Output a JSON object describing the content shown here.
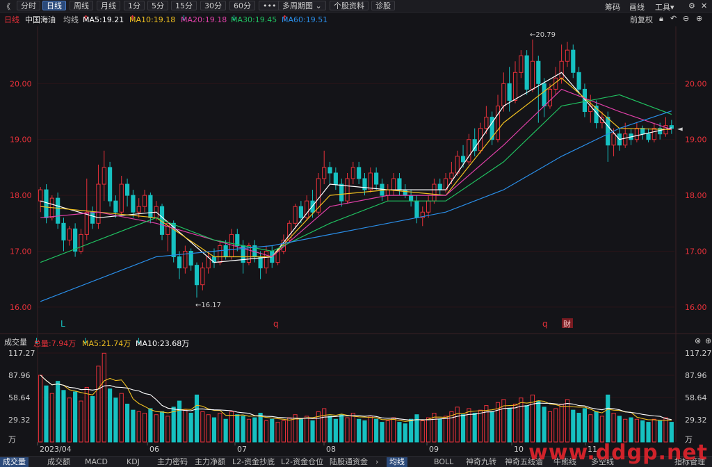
{
  "toolbar": {
    "back": "《",
    "tabs": [
      "分时",
      "日线",
      "周线",
      "月线",
      "1分",
      "5分",
      "15分",
      "30分",
      "60分",
      "•••",
      "多周期图",
      "个股资料",
      "诊股"
    ],
    "active_tab": "日线",
    "right": [
      "筹码",
      "画线",
      "工具"
    ]
  },
  "header": {
    "period": "日线",
    "name": "中国海油",
    "avg_label": "均线",
    "ma5": "MA5:19.21",
    "ma10": "MA10:19.18",
    "ma20": "MA20:19.18",
    "ma30": "MA30:19.45",
    "ma60": "MA60:19.51",
    "ma5_arrow": "↑",
    "ma10_arrow": "↑",
    "ma20_arrow": "↓",
    "ma30_arrow": "↓",
    "ma60_arrow": "↑",
    "adjust": "前复权"
  },
  "colors": {
    "up": "#e8313a",
    "down": "#16c1c1",
    "ma5": "#ffffff",
    "ma10": "#f0c020",
    "ma20": "#e040a8",
    "ma30": "#20c060",
    "ma60": "#2a8ee8",
    "grid": "#2a1418"
  },
  "price_axis": {
    "ticks": [
      "20.00",
      "19.00",
      "18.00",
      "17.00",
      "16.00"
    ]
  },
  "annotations": {
    "high": "20.79",
    "low": "16.17",
    "markers": [
      "L",
      "q",
      "q",
      "财"
    ]
  },
  "volume": {
    "title": "成交量",
    "total": "总量:7.94万",
    "total_arrow": "↓",
    "ma5": "MA5:21.74万",
    "ma5_arrow": "↓",
    "ma10": "MA10:23.68万",
    "ma10_arrow": "↓",
    "ticks": [
      "117.27",
      "87.96",
      "58.64",
      "29.32",
      "万"
    ]
  },
  "xaxis": {
    "labels": [
      "2023/04",
      "06",
      "07",
      "08",
      "09",
      "10",
      "11"
    ]
  },
  "bottom_tabs_left": [
    "成交量",
    "成交额",
    "MACD",
    "KDJ",
    "主力密码",
    "主力净额",
    "L2-资金抄底",
    "L2-资金仓位",
    "陆股通资金"
  ],
  "bottom_tabs_right": [
    "均线",
    "BOLL",
    "神奇九转",
    "神奇五线谱",
    "牛熊线",
    "多空线",
    "指标管理"
  ],
  "watermark": "www.ddgp.net",
  "chart_data": {
    "type": "candlestick",
    "title": "中国海油 日线",
    "ylim": [
      15.7,
      20.95
    ],
    "candles": [
      [
        17.9,
        18.1,
        17.7,
        18.15
      ],
      [
        18.1,
        17.6,
        17.5,
        18.2
      ],
      [
        17.6,
        17.95,
        17.55,
        18.0
      ],
      [
        17.95,
        17.5,
        17.4,
        18.05
      ],
      [
        17.5,
        17.2,
        17.0,
        17.6
      ],
      [
        17.2,
        17.4,
        17.1,
        17.45
      ],
      [
        17.4,
        17.0,
        16.9,
        17.5
      ],
      [
        17.0,
        17.3,
        16.95,
        17.4
      ],
      [
        17.3,
        17.7,
        17.2,
        18.3
      ],
      [
        17.7,
        17.5,
        17.4,
        17.8
      ],
      [
        17.5,
        18.2,
        17.4,
        18.55
      ],
      [
        18.2,
        18.5,
        17.9,
        18.8
      ],
      [
        18.5,
        17.9,
        17.8,
        18.6
      ],
      [
        17.9,
        17.7,
        17.6,
        18.0
      ],
      [
        17.7,
        18.2,
        17.65,
        18.35
      ],
      [
        18.2,
        18.0,
        17.8,
        18.3
      ],
      [
        18.0,
        17.7,
        17.6,
        18.1
      ],
      [
        17.7,
        17.8,
        17.6,
        17.95
      ],
      [
        17.8,
        18.0,
        17.7,
        18.1
      ],
      [
        18.0,
        17.6,
        17.5,
        18.05
      ],
      [
        17.6,
        17.8,
        17.55,
        17.9
      ],
      [
        17.8,
        17.3,
        17.2,
        17.85
      ],
      [
        17.3,
        17.5,
        17.0,
        17.55
      ],
      [
        17.5,
        16.9,
        16.8,
        17.55
      ],
      [
        16.9,
        16.7,
        16.5,
        17.0
      ],
      [
        16.7,
        17.0,
        16.6,
        17.1
      ],
      [
        17.0,
        16.75,
        16.65,
        17.05
      ],
      [
        16.75,
        16.4,
        16.17,
        16.8
      ],
      [
        16.4,
        16.7,
        16.3,
        16.8
      ],
      [
        16.7,
        16.9,
        16.6,
        17.0
      ],
      [
        16.9,
        16.8,
        16.7,
        17.05
      ],
      [
        16.8,
        17.1,
        16.75,
        17.2
      ],
      [
        17.1,
        16.9,
        16.85,
        17.2
      ],
      [
        16.9,
        17.3,
        16.85,
        17.4
      ],
      [
        17.3,
        17.1,
        17.0,
        17.4
      ],
      [
        17.1,
        16.8,
        16.6,
        17.2
      ],
      [
        16.8,
        17.1,
        16.75,
        17.15
      ],
      [
        17.1,
        16.9,
        16.8,
        17.2
      ],
      [
        16.9,
        16.7,
        16.5,
        17.0
      ],
      [
        16.7,
        17.0,
        16.6,
        17.1
      ],
      [
        17.0,
        16.8,
        16.7,
        17.1
      ],
      [
        16.8,
        17.0,
        16.75,
        17.05
      ],
      [
        17.0,
        17.2,
        16.95,
        17.3
      ],
      [
        17.2,
        17.5,
        17.15,
        17.55
      ],
      [
        17.5,
        17.8,
        17.4,
        17.85
      ],
      [
        17.8,
        17.6,
        17.5,
        17.9
      ],
      [
        17.6,
        17.9,
        17.55,
        18.0
      ],
      [
        17.9,
        17.7,
        17.6,
        18.1
      ],
      [
        17.7,
        18.3,
        17.65,
        18.4
      ],
      [
        18.3,
        18.5,
        18.2,
        18.8
      ],
      [
        18.5,
        18.4,
        18.2,
        18.6
      ],
      [
        18.4,
        18.2,
        18.1,
        18.5
      ],
      [
        18.2,
        17.9,
        17.8,
        18.3
      ],
      [
        17.9,
        18.3,
        17.85,
        18.4
      ],
      [
        18.3,
        18.5,
        18.2,
        18.6
      ],
      [
        18.5,
        18.3,
        18.2,
        18.6
      ],
      [
        18.3,
        18.1,
        18.0,
        18.4
      ],
      [
        18.1,
        18.4,
        18.05,
        18.5
      ],
      [
        18.4,
        18.2,
        18.1,
        18.5
      ],
      [
        18.2,
        18.0,
        17.9,
        18.3
      ],
      [
        18.0,
        18.1,
        17.9,
        18.2
      ],
      [
        18.1,
        18.3,
        18.0,
        18.4
      ],
      [
        18.3,
        18.1,
        18.0,
        18.4
      ],
      [
        18.1,
        18.0,
        17.95,
        18.2
      ],
      [
        18.0,
        17.9,
        17.8,
        18.1
      ],
      [
        17.9,
        17.6,
        17.5,
        18.0
      ],
      [
        17.6,
        17.7,
        17.45,
        17.8
      ],
      [
        17.7,
        17.9,
        17.6,
        18.0
      ],
      [
        17.9,
        18.2,
        17.85,
        18.3
      ],
      [
        18.2,
        18.1,
        18.0,
        18.3
      ],
      [
        18.1,
        18.3,
        18.05,
        18.4
      ],
      [
        18.3,
        18.4,
        18.2,
        18.6
      ],
      [
        18.4,
        18.7,
        18.35,
        18.8
      ],
      [
        18.7,
        18.6,
        18.5,
        18.9
      ],
      [
        18.6,
        19.0,
        18.55,
        19.1
      ],
      [
        19.0,
        18.8,
        18.7,
        19.2
      ],
      [
        18.8,
        19.2,
        18.75,
        19.3
      ],
      [
        19.2,
        19.4,
        19.1,
        19.6
      ],
      [
        19.4,
        19.0,
        18.9,
        19.5
      ],
      [
        19.0,
        19.6,
        18.95,
        19.8
      ],
      [
        19.6,
        20.0,
        19.5,
        20.2
      ],
      [
        20.0,
        19.7,
        19.5,
        20.3
      ],
      [
        19.7,
        20.2,
        19.65,
        20.4
      ],
      [
        20.2,
        20.5,
        20.1,
        20.6
      ],
      [
        20.5,
        19.9,
        19.8,
        20.6
      ],
      [
        19.9,
        20.4,
        19.85,
        20.79
      ],
      [
        20.4,
        20.0,
        19.3,
        20.5
      ],
      [
        20.0,
        19.6,
        19.4,
        20.1
      ],
      [
        19.6,
        19.9,
        19.55,
        20.0
      ],
      [
        19.9,
        20.1,
        19.8,
        20.3
      ],
      [
        20.1,
        20.4,
        20.0,
        20.7
      ],
      [
        20.4,
        20.6,
        20.3,
        20.75
      ],
      [
        20.6,
        20.2,
        20.1,
        20.7
      ],
      [
        20.2,
        19.9,
        19.8,
        20.3
      ],
      [
        19.9,
        19.5,
        19.4,
        20.0
      ],
      [
        19.5,
        19.6,
        19.3,
        19.8
      ],
      [
        19.6,
        19.3,
        19.2,
        19.7
      ],
      [
        19.3,
        19.4,
        19.2,
        19.5
      ],
      [
        19.4,
        18.9,
        18.6,
        19.5
      ],
      [
        18.9,
        19.1,
        18.7,
        19.2
      ],
      [
        19.1,
        18.9,
        18.8,
        19.2
      ],
      [
        18.9,
        19.1,
        18.85,
        19.3
      ],
      [
        19.1,
        19.0,
        18.9,
        19.2
      ],
      [
        19.0,
        19.2,
        18.95,
        19.3
      ],
      [
        19.2,
        19.1,
        19.0,
        19.25
      ],
      [
        19.1,
        19.0,
        18.95,
        19.2
      ],
      [
        19.0,
        19.2,
        18.95,
        19.3
      ],
      [
        19.2,
        19.1,
        19.0,
        19.3
      ],
      [
        19.1,
        19.25,
        19.05,
        19.4
      ],
      [
        19.25,
        19.2,
        19.1,
        19.35
      ]
    ],
    "volumes": [
      [
        88,
        1
      ],
      [
        74,
        0
      ],
      [
        64,
        1
      ],
      [
        80,
        0
      ],
      [
        68,
        0
      ],
      [
        58,
        1
      ],
      [
        66,
        0
      ],
      [
        54,
        1
      ],
      [
        72,
        1
      ],
      [
        60,
        0
      ],
      [
        100,
        1
      ],
      [
        117,
        1
      ],
      [
        70,
        0
      ],
      [
        58,
        0
      ],
      [
        64,
        1
      ],
      [
        50,
        0
      ],
      [
        42,
        0
      ],
      [
        40,
        1
      ],
      [
        38,
        1
      ],
      [
        44,
        0
      ],
      [
        36,
        1
      ],
      [
        40,
        0
      ],
      [
        34,
        1
      ],
      [
        46,
        0
      ],
      [
        54,
        0
      ],
      [
        42,
        1
      ],
      [
        38,
        0
      ],
      [
        62,
        0
      ],
      [
        40,
        1
      ],
      [
        36,
        1
      ],
      [
        32,
        0
      ],
      [
        38,
        1
      ],
      [
        30,
        0
      ],
      [
        40,
        1
      ],
      [
        36,
        0
      ],
      [
        34,
        0
      ],
      [
        30,
        1
      ],
      [
        32,
        0
      ],
      [
        38,
        0
      ],
      [
        28,
        1
      ],
      [
        30,
        0
      ],
      [
        26,
        1
      ],
      [
        28,
        1
      ],
      [
        32,
        1
      ],
      [
        36,
        1
      ],
      [
        30,
        0
      ],
      [
        34,
        1
      ],
      [
        28,
        0
      ],
      [
        40,
        1
      ],
      [
        44,
        1
      ],
      [
        34,
        0
      ],
      [
        30,
        0
      ],
      [
        36,
        0
      ],
      [
        32,
        1
      ],
      [
        38,
        1
      ],
      [
        30,
        0
      ],
      [
        28,
        0
      ],
      [
        34,
        1
      ],
      [
        30,
        0
      ],
      [
        26,
        0
      ],
      [
        28,
        1
      ],
      [
        32,
        1
      ],
      [
        26,
        0
      ],
      [
        24,
        0
      ],
      [
        30,
        0
      ],
      [
        36,
        0
      ],
      [
        28,
        1
      ],
      [
        32,
        1
      ],
      [
        38,
        1
      ],
      [
        30,
        0
      ],
      [
        34,
        1
      ],
      [
        40,
        1
      ],
      [
        46,
        1
      ],
      [
        36,
        0
      ],
      [
        44,
        1
      ],
      [
        38,
        0
      ],
      [
        42,
        1
      ],
      [
        48,
        1
      ],
      [
        40,
        0
      ],
      [
        52,
        1
      ],
      [
        56,
        1
      ],
      [
        44,
        0
      ],
      [
        50,
        1
      ],
      [
        58,
        1
      ],
      [
        48,
        0
      ],
      [
        62,
        1
      ],
      [
        54,
        0
      ],
      [
        46,
        0
      ],
      [
        40,
        1
      ],
      [
        44,
        1
      ],
      [
        50,
        1
      ],
      [
        56,
        1
      ],
      [
        42,
        0
      ],
      [
        38,
        0
      ],
      [
        44,
        0
      ],
      [
        36,
        1
      ],
      [
        40,
        0
      ],
      [
        34,
        1
      ],
      [
        62,
        0
      ],
      [
        38,
        1
      ],
      [
        34,
        0
      ],
      [
        30,
        1
      ],
      [
        32,
        0
      ],
      [
        30,
        1
      ],
      [
        28,
        0
      ],
      [
        26,
        0
      ],
      [
        30,
        1
      ],
      [
        28,
        0
      ],
      [
        32,
        1
      ],
      [
        26,
        0
      ]
    ],
    "ma_lines": {
      "MA5": [
        [
          0,
          17.9
        ],
        [
          10,
          17.6
        ],
        [
          20,
          17.7
        ],
        [
          30,
          16.8
        ],
        [
          40,
          16.9
        ],
        [
          50,
          18.2
        ],
        [
          60,
          18.1
        ],
        [
          70,
          18.1
        ],
        [
          80,
          19.6
        ],
        [
          90,
          20.2
        ],
        [
          100,
          19.0
        ],
        [
          109,
          19.21
        ]
      ],
      "MA10": [
        [
          0,
          17.8
        ],
        [
          10,
          17.7
        ],
        [
          20,
          17.6
        ],
        [
          30,
          16.9
        ],
        [
          40,
          16.9
        ],
        [
          50,
          18.0
        ],
        [
          60,
          18.1
        ],
        [
          70,
          18.0
        ],
        [
          80,
          19.3
        ],
        [
          90,
          20.1
        ],
        [
          100,
          19.2
        ],
        [
          109,
          19.18
        ]
      ],
      "MA20": [
        [
          0,
          17.6
        ],
        [
          10,
          17.7
        ],
        [
          20,
          17.5
        ],
        [
          30,
          17.2
        ],
        [
          40,
          16.9
        ],
        [
          50,
          17.8
        ],
        [
          60,
          18.0
        ],
        [
          70,
          18.0
        ],
        [
          80,
          18.9
        ],
        [
          90,
          19.9
        ],
        [
          100,
          19.5
        ],
        [
          109,
          19.18
        ]
      ],
      "MA30": [
        [
          0,
          16.8
        ],
        [
          10,
          17.2
        ],
        [
          20,
          17.6
        ],
        [
          30,
          17.2
        ],
        [
          40,
          17.0
        ],
        [
          50,
          17.5
        ],
        [
          60,
          17.9
        ],
        [
          70,
          17.9
        ],
        [
          80,
          18.6
        ],
        [
          90,
          19.6
        ],
        [
          100,
          19.8
        ],
        [
          109,
          19.45
        ]
      ],
      "MA60": [
        [
          0,
          16.1
        ],
        [
          10,
          16.5
        ],
        [
          20,
          16.9
        ],
        [
          30,
          17.0
        ],
        [
          40,
          17.1
        ],
        [
          50,
          17.3
        ],
        [
          60,
          17.5
        ],
        [
          70,
          17.7
        ],
        [
          80,
          18.1
        ],
        [
          90,
          18.7
        ],
        [
          100,
          19.2
        ],
        [
          109,
          19.51
        ]
      ]
    }
  }
}
